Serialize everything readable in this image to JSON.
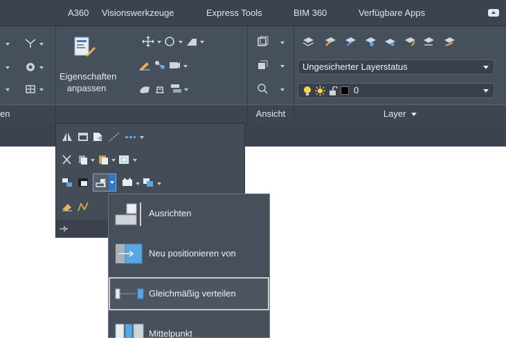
{
  "tabs": [
    "A360",
    "Visionswerkzeuge",
    "Express Tools",
    "BIM 360",
    "Verfügbare Apps"
  ],
  "panels": {
    "left_partial_title": "en",
    "properties": {
      "line1": "Eigenschaften",
      "line2": "anpassen"
    },
    "view_title": "Ansicht",
    "layer_title": "Layer"
  },
  "layer": {
    "state_value": "Ungesicherter Layerstatus",
    "current_layer": "0",
    "current_color": "#000000"
  },
  "menu": {
    "items": [
      {
        "label": "Ausrichten",
        "icon": "align-icon"
      },
      {
        "label": "Neu positionieren von",
        "icon": "reposition-icon"
      },
      {
        "label": "Gleichmäßig verteilen",
        "icon": "distribute-evenly-icon",
        "active": true
      },
      {
        "label": "Mittelpunkt",
        "icon": "midpoint-icon"
      }
    ]
  },
  "colors": {
    "tabbar": "#3b4350",
    "ribbon": "#464f5c",
    "accent_blue": "#5aa6e0",
    "highlight_border": "#c9cdd2"
  }
}
